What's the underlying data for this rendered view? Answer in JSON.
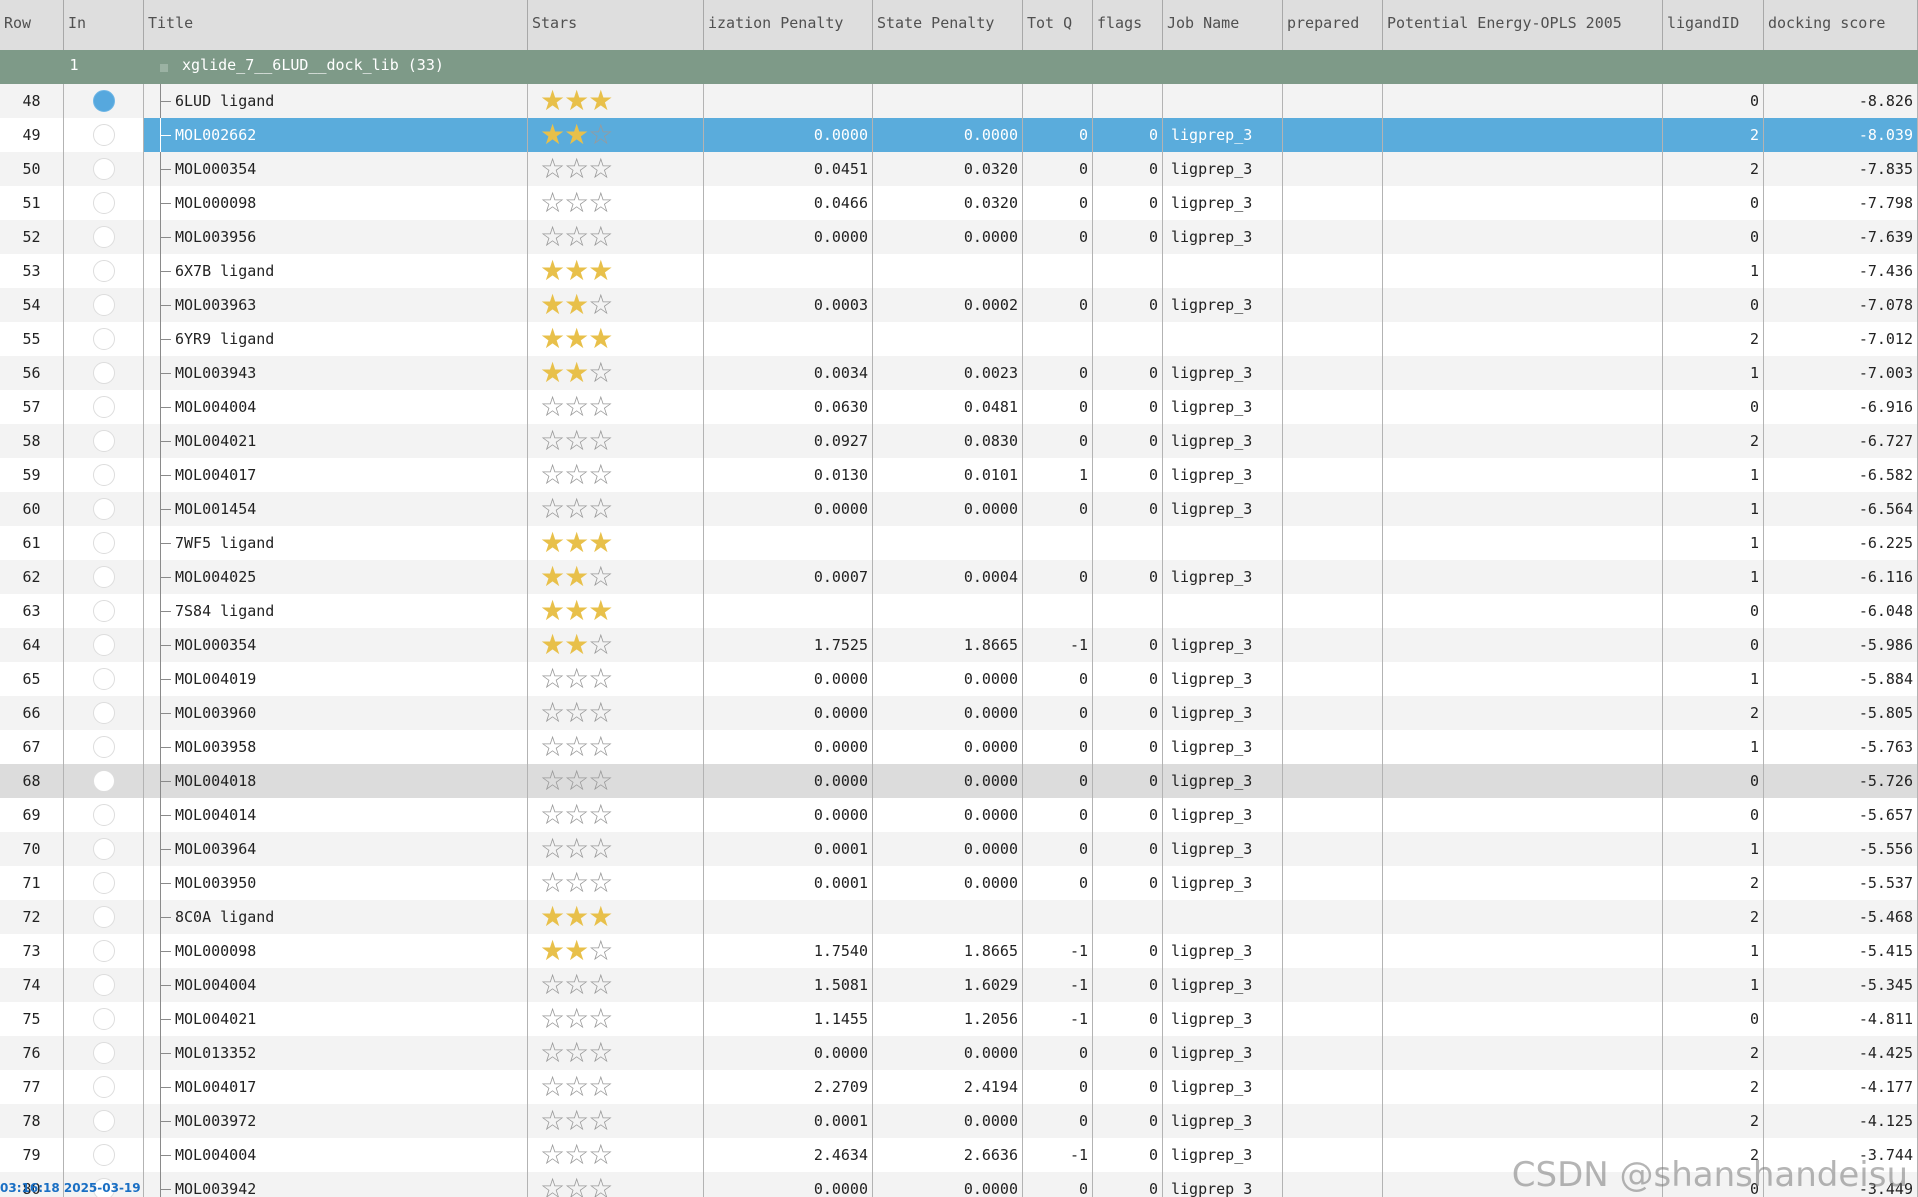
{
  "columns": [
    "Row",
    "In",
    "Title",
    "Stars",
    "ization Penalty",
    "State Penalty",
    "Tot Q",
    "flags",
    "Job Name",
    "prepared",
    "Potential Energy-OPLS 2005",
    "ligandID",
    "docking score"
  ],
  "group": {
    "row": "1",
    "title": "xglide_7__6LUD__dock_lib (33)"
  },
  "selected_row": "49",
  "hover_row": "68",
  "colors": {
    "header_bg": "#dedede",
    "group_bg": "#7e9a88",
    "selection_bg": "#5aacdc",
    "star_gold": "#e8c04a",
    "radio_on": "#56a8de"
  },
  "rows": [
    {
      "row": "48",
      "in": true,
      "title": "6LUD ligand",
      "stars": 3,
      "ion": "",
      "state": "",
      "totq": "",
      "flags": "",
      "job": "",
      "ligandID": "0",
      "score": "-8.826"
    },
    {
      "row": "49",
      "in": false,
      "title": "MOL002662",
      "stars": 2,
      "ion": "0.0000",
      "state": "0.0000",
      "totq": "0",
      "flags": "0",
      "job": "ligprep_3",
      "ligandID": "2",
      "score": "-8.039"
    },
    {
      "row": "50",
      "in": false,
      "title": "MOL000354",
      "stars": 0,
      "ion": "0.0451",
      "state": "0.0320",
      "totq": "0",
      "flags": "0",
      "job": "ligprep_3",
      "ligandID": "2",
      "score": "-7.835"
    },
    {
      "row": "51",
      "in": false,
      "title": "MOL000098",
      "stars": 0,
      "ion": "0.0466",
      "state": "0.0320",
      "totq": "0",
      "flags": "0",
      "job": "ligprep_3",
      "ligandID": "0",
      "score": "-7.798"
    },
    {
      "row": "52",
      "in": false,
      "title": "MOL003956",
      "stars": 0,
      "ion": "0.0000",
      "state": "0.0000",
      "totq": "0",
      "flags": "0",
      "job": "ligprep_3",
      "ligandID": "0",
      "score": "-7.639"
    },
    {
      "row": "53",
      "in": false,
      "title": "6X7B ligand",
      "stars": 3,
      "ion": "",
      "state": "",
      "totq": "",
      "flags": "",
      "job": "",
      "ligandID": "1",
      "score": "-7.436"
    },
    {
      "row": "54",
      "in": false,
      "title": "MOL003963",
      "stars": 2,
      "ion": "0.0003",
      "state": "0.0002",
      "totq": "0",
      "flags": "0",
      "job": "ligprep_3",
      "ligandID": "0",
      "score": "-7.078"
    },
    {
      "row": "55",
      "in": false,
      "title": "6YR9 ligand",
      "stars": 3,
      "ion": "",
      "state": "",
      "totq": "",
      "flags": "",
      "job": "",
      "ligandID": "2",
      "score": "-7.012"
    },
    {
      "row": "56",
      "in": false,
      "title": "MOL003943",
      "stars": 2,
      "ion": "0.0034",
      "state": "0.0023",
      "totq": "0",
      "flags": "0",
      "job": "ligprep_3",
      "ligandID": "1",
      "score": "-7.003"
    },
    {
      "row": "57",
      "in": false,
      "title": "MOL004004",
      "stars": 0,
      "ion": "0.0630",
      "state": "0.0481",
      "totq": "0",
      "flags": "0",
      "job": "ligprep_3",
      "ligandID": "0",
      "score": "-6.916"
    },
    {
      "row": "58",
      "in": false,
      "title": "MOL004021",
      "stars": 0,
      "ion": "0.0927",
      "state": "0.0830",
      "totq": "0",
      "flags": "0",
      "job": "ligprep_3",
      "ligandID": "2",
      "score": "-6.727"
    },
    {
      "row": "59",
      "in": false,
      "title": "MOL004017",
      "stars": 0,
      "ion": "0.0130",
      "state": "0.0101",
      "totq": "1",
      "flags": "0",
      "job": "ligprep_3",
      "ligandID": "1",
      "score": "-6.582"
    },
    {
      "row": "60",
      "in": false,
      "title": "MOL001454",
      "stars": 0,
      "ion": "0.0000",
      "state": "0.0000",
      "totq": "0",
      "flags": "0",
      "job": "ligprep_3",
      "ligandID": "1",
      "score": "-6.564"
    },
    {
      "row": "61",
      "in": false,
      "title": "7WF5 ligand",
      "stars": 3,
      "ion": "",
      "state": "",
      "totq": "",
      "flags": "",
      "job": "",
      "ligandID": "1",
      "score": "-6.225"
    },
    {
      "row": "62",
      "in": false,
      "title": "MOL004025",
      "stars": 2,
      "ion": "0.0007",
      "state": "0.0004",
      "totq": "0",
      "flags": "0",
      "job": "ligprep_3",
      "ligandID": "1",
      "score": "-6.116"
    },
    {
      "row": "63",
      "in": false,
      "title": "7S84 ligand",
      "stars": 3,
      "ion": "",
      "state": "",
      "totq": "",
      "flags": "",
      "job": "",
      "ligandID": "0",
      "score": "-6.048"
    },
    {
      "row": "64",
      "in": false,
      "title": "MOL000354",
      "stars": 2,
      "ion": "1.7525",
      "state": "1.8665",
      "totq": "-1",
      "flags": "0",
      "job": "ligprep_3",
      "ligandID": "0",
      "score": "-5.986"
    },
    {
      "row": "65",
      "in": false,
      "title": "MOL004019",
      "stars": 0,
      "ion": "0.0000",
      "state": "0.0000",
      "totq": "0",
      "flags": "0",
      "job": "ligprep_3",
      "ligandID": "1",
      "score": "-5.884"
    },
    {
      "row": "66",
      "in": false,
      "title": "MOL003960",
      "stars": 0,
      "ion": "0.0000",
      "state": "0.0000",
      "totq": "0",
      "flags": "0",
      "job": "ligprep_3",
      "ligandID": "2",
      "score": "-5.805"
    },
    {
      "row": "67",
      "in": false,
      "title": "MOL003958",
      "stars": 0,
      "ion": "0.0000",
      "state": "0.0000",
      "totq": "0",
      "flags": "0",
      "job": "ligprep_3",
      "ligandID": "1",
      "score": "-5.763"
    },
    {
      "row": "68",
      "in": false,
      "title": "MOL004018",
      "stars": 0,
      "ion": "0.0000",
      "state": "0.0000",
      "totq": "0",
      "flags": "0",
      "job": "ligprep_3",
      "ligandID": "0",
      "score": "-5.726"
    },
    {
      "row": "69",
      "in": false,
      "title": "MOL004014",
      "stars": 0,
      "ion": "0.0000",
      "state": "0.0000",
      "totq": "0",
      "flags": "0",
      "job": "ligprep_3",
      "ligandID": "0",
      "score": "-5.657"
    },
    {
      "row": "70",
      "in": false,
      "title": "MOL003964",
      "stars": 0,
      "ion": "0.0001",
      "state": "0.0000",
      "totq": "0",
      "flags": "0",
      "job": "ligprep_3",
      "ligandID": "1",
      "score": "-5.556"
    },
    {
      "row": "71",
      "in": false,
      "title": "MOL003950",
      "stars": 0,
      "ion": "0.0001",
      "state": "0.0000",
      "totq": "0",
      "flags": "0",
      "job": "ligprep_3",
      "ligandID": "2",
      "score": "-5.537"
    },
    {
      "row": "72",
      "in": false,
      "title": "8C0A ligand",
      "stars": 3,
      "ion": "",
      "state": "",
      "totq": "",
      "flags": "",
      "job": "",
      "ligandID": "2",
      "score": "-5.468"
    },
    {
      "row": "73",
      "in": false,
      "title": "MOL000098",
      "stars": 2,
      "ion": "1.7540",
      "state": "1.8665",
      "totq": "-1",
      "flags": "0",
      "job": "ligprep_3",
      "ligandID": "1",
      "score": "-5.415"
    },
    {
      "row": "74",
      "in": false,
      "title": "MOL004004",
      "stars": 0,
      "ion": "1.5081",
      "state": "1.6029",
      "totq": "-1",
      "flags": "0",
      "job": "ligprep_3",
      "ligandID": "1",
      "score": "-5.345"
    },
    {
      "row": "75",
      "in": false,
      "title": "MOL004021",
      "stars": 0,
      "ion": "1.1455",
      "state": "1.2056",
      "totq": "-1",
      "flags": "0",
      "job": "ligprep_3",
      "ligandID": "0",
      "score": "-4.811"
    },
    {
      "row": "76",
      "in": false,
      "title": "MOL013352",
      "stars": 0,
      "ion": "0.0000",
      "state": "0.0000",
      "totq": "0",
      "flags": "0",
      "job": "ligprep_3",
      "ligandID": "2",
      "score": "-4.425"
    },
    {
      "row": "77",
      "in": false,
      "title": "MOL004017",
      "stars": 0,
      "ion": "2.2709",
      "state": "2.4194",
      "totq": "0",
      "flags": "0",
      "job": "ligprep_3",
      "ligandID": "2",
      "score": "-4.177"
    },
    {
      "row": "78",
      "in": false,
      "title": "MOL003972",
      "stars": 0,
      "ion": "0.0001",
      "state": "0.0000",
      "totq": "0",
      "flags": "0",
      "job": "ligprep_3",
      "ligandID": "2",
      "score": "-4.125"
    },
    {
      "row": "79",
      "in": false,
      "title": "MOL004004",
      "stars": 0,
      "ion": "2.4634",
      "state": "2.6636",
      "totq": "-1",
      "flags": "0",
      "job": "ligprep_3",
      "ligandID": "2",
      "score": "-3.744"
    },
    {
      "row": "80",
      "in": false,
      "title": "MOL003942",
      "stars": 0,
      "ion": "0.0000",
      "state": "0.0000",
      "totq": "0",
      "flags": "0",
      "job": "ligprep_3",
      "ligandID": "0",
      "score": "-3.449"
    }
  ],
  "watermark": "CSDN @shanshandeisu",
  "timestamp": "03:16:18 2025-03-19"
}
